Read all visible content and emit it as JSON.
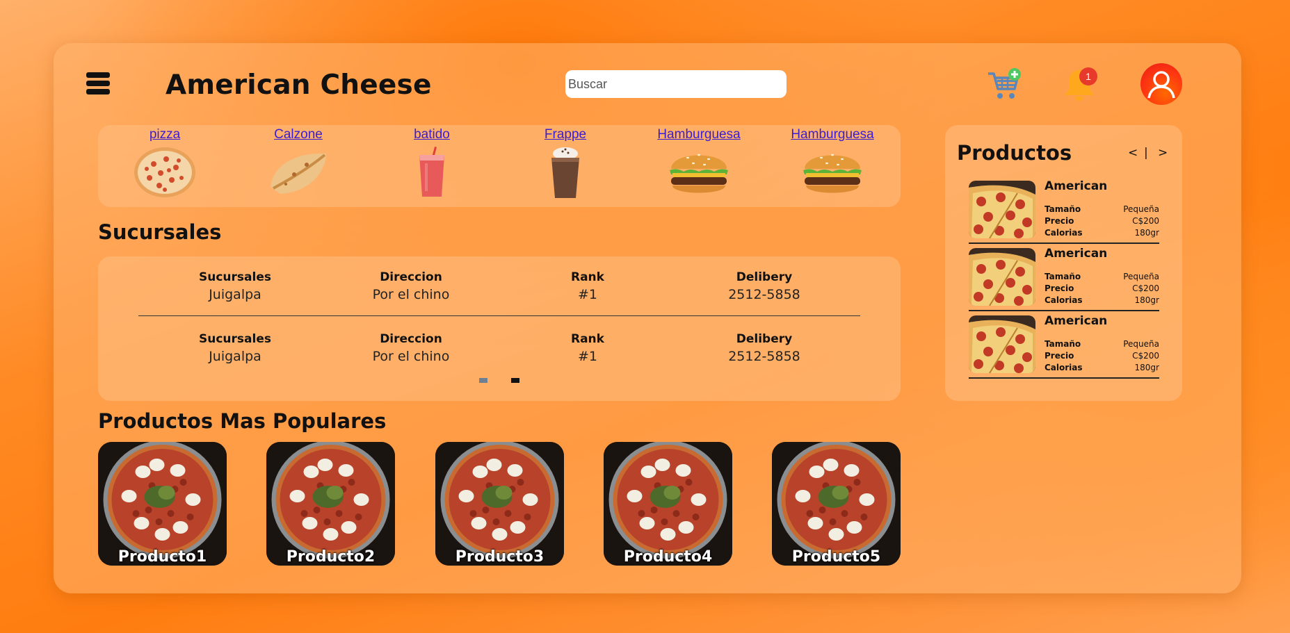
{
  "header": {
    "title": "American Cheese",
    "search_placeholder": "Buscar",
    "notification_count": "1",
    "icons": [
      "menu-icon",
      "cart-add-icon",
      "bell-icon",
      "user-avatar-icon"
    ]
  },
  "categories": [
    {
      "label": "pizza",
      "icon": "pizza-icon"
    },
    {
      "label": "Calzone",
      "icon": "calzone-icon"
    },
    {
      "label": "batido",
      "icon": "smoothie-icon"
    },
    {
      "label": "Frappe",
      "icon": "frappe-icon"
    },
    {
      "label": "Hamburguesa",
      "icon": "burger-icon"
    },
    {
      "label": "Hamburguesa",
      "icon": "burger-icon"
    }
  ],
  "branches": {
    "title": "Sucursales",
    "headers": [
      "Sucursales",
      "Direccion",
      "Rank",
      "Delibery"
    ],
    "rows": [
      [
        "Juigalpa",
        "Por el chino",
        "#1",
        "2512-5858"
      ],
      [
        "Juigalpa",
        "Por el chino",
        "#1",
        "2512-5858"
      ]
    ],
    "pagination": {
      "pages": 2,
      "active_page": 2
    }
  },
  "popular": {
    "title": "Productos Mas Populares",
    "items": [
      "Producto1",
      "Producto2",
      "Producto3",
      "Producto4",
      "Producto5"
    ]
  },
  "products": {
    "title": "Productos",
    "nav_prev": "<",
    "nav_sep": "|",
    "nav_next": ">",
    "spec_labels": {
      "size": "Tamaño",
      "price": "Precio",
      "calories": "Calorias"
    },
    "items": [
      {
        "name": "American",
        "size": "Pequeña",
        "price": "C$200",
        "calories": "180gr"
      },
      {
        "name": "American",
        "size": "Pequeña",
        "price": "C$200",
        "calories": "180gr"
      },
      {
        "name": "American",
        "size": "Pequeña",
        "price": "C$200",
        "calories": "180gr"
      }
    ]
  },
  "colors": {
    "background": "#ff8a24",
    "panel": "#ffbe82",
    "link": "#3b1dd2",
    "badge": "#e83a2a"
  }
}
